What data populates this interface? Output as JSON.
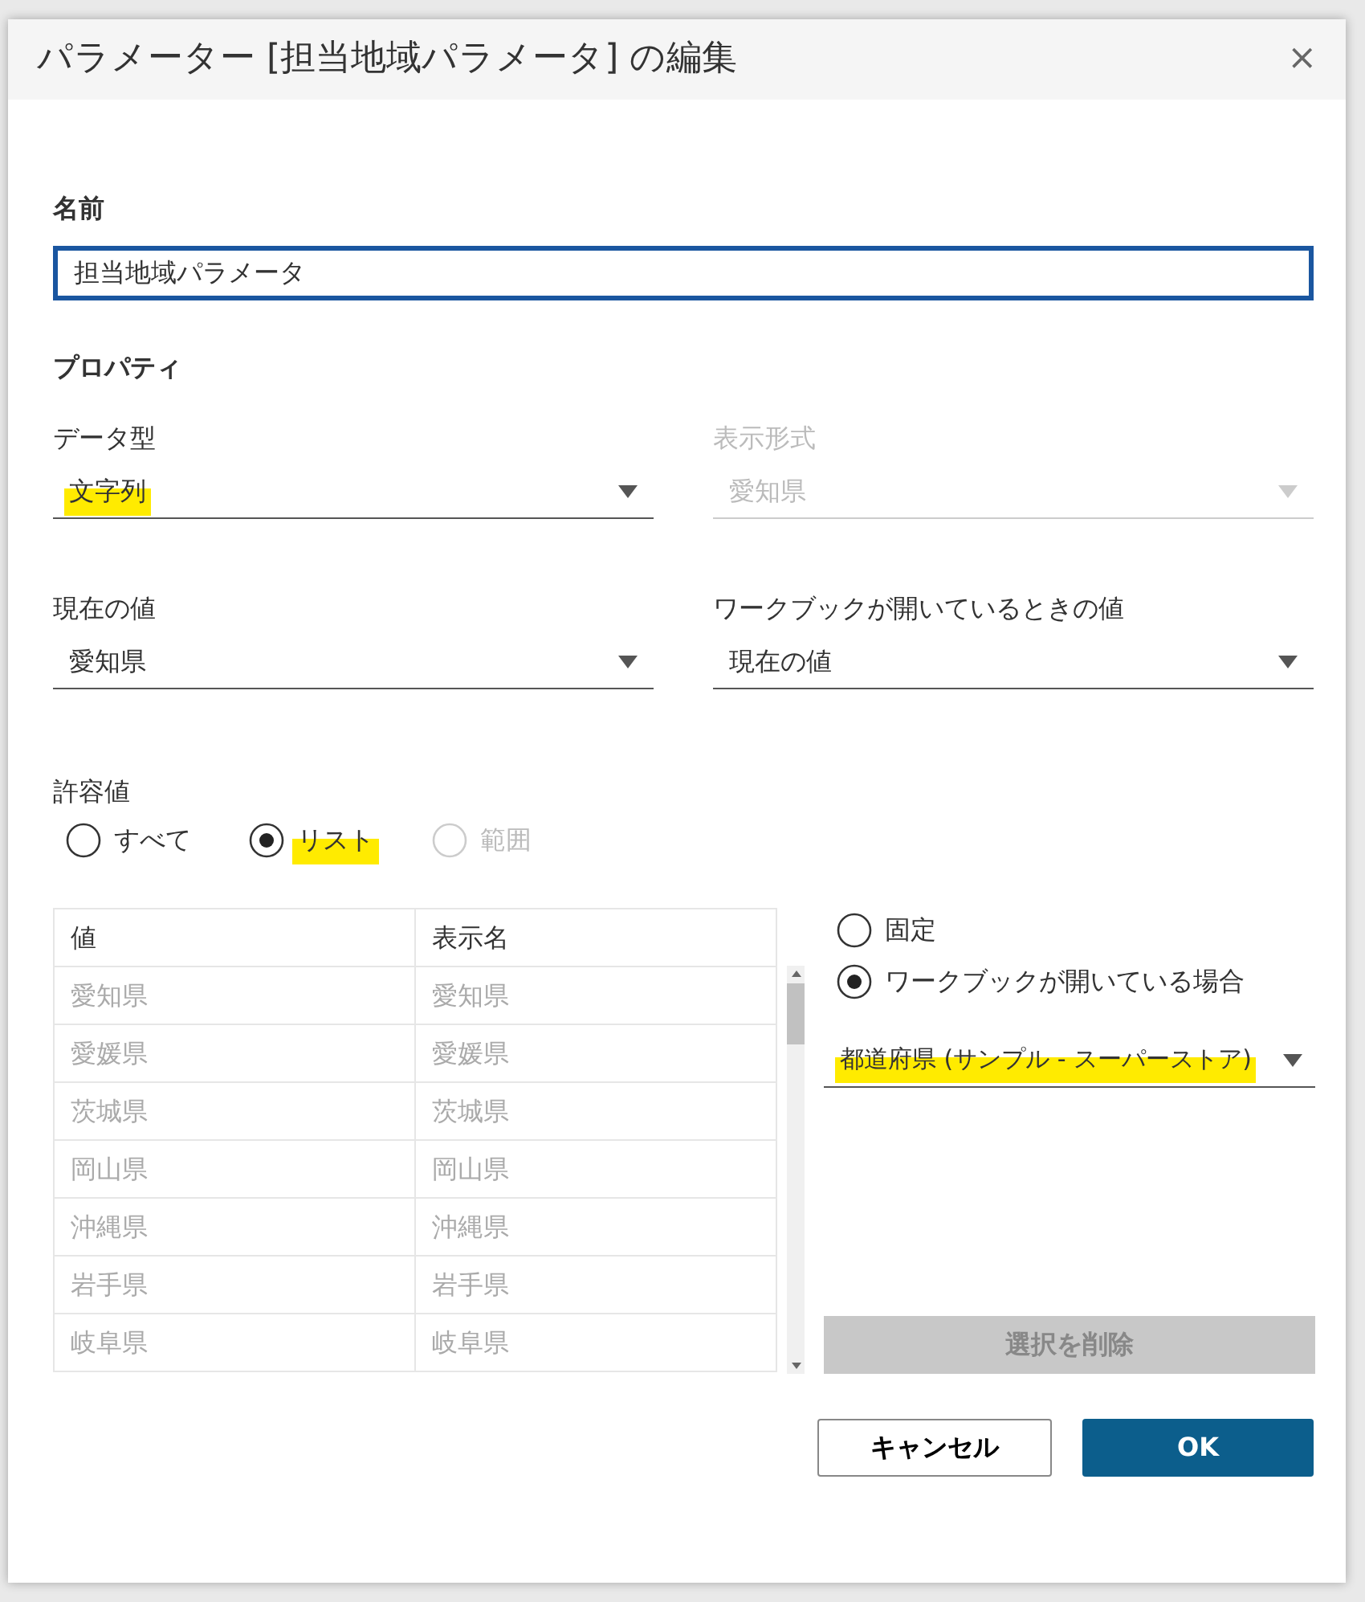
{
  "dialog": {
    "title": "パラメーター [担当地域パラメータ] の編集",
    "close": "×"
  },
  "name_section": {
    "label": "名前",
    "value": "担当地域パラメータ"
  },
  "properties": {
    "heading": "プロパティ",
    "dropdowns": [
      {
        "label": "データ型",
        "value": "文字列",
        "disabled": false,
        "highlighted": true
      },
      {
        "label": "表示形式",
        "value": "愛知県",
        "disabled": true,
        "highlighted": false
      },
      {
        "label": "現在の値",
        "value": "愛知県",
        "disabled": false,
        "highlighted": false
      },
      {
        "label": "ワークブックが開いているときの値",
        "value": "現在の値",
        "disabled": false,
        "highlighted": false
      }
    ]
  },
  "allowable": {
    "label": "許容値",
    "options": [
      {
        "label": "すべて",
        "selected": false,
        "disabled": false,
        "highlighted": false
      },
      {
        "label": "リスト",
        "selected": true,
        "disabled": false,
        "highlighted": true
      },
      {
        "label": "範囲",
        "selected": false,
        "disabled": true,
        "highlighted": false
      }
    ]
  },
  "list_table": {
    "columns": [
      "値",
      "表示名"
    ],
    "rows": [
      [
        "愛知県",
        "愛知県"
      ],
      [
        "愛媛県",
        "愛媛県"
      ],
      [
        "茨城県",
        "茨城県"
      ],
      [
        "岡山県",
        "岡山県"
      ],
      [
        "沖縄県",
        "沖縄県"
      ],
      [
        "岩手県",
        "岩手県"
      ],
      [
        "岐阜県",
        "岐阜県"
      ]
    ]
  },
  "source": {
    "options": [
      {
        "label": "固定",
        "selected": false
      },
      {
        "label": "ワークブックが開いている場合",
        "selected": true
      }
    ],
    "field": {
      "value": "都道府県 (サンプル - スーパーストア)",
      "highlighted": true
    },
    "remove_button": {
      "label": "選択を削除",
      "disabled": true
    }
  },
  "buttons": [
    {
      "label": "キャンセル",
      "kind": "secondary"
    },
    {
      "label": "OK",
      "kind": "primary"
    }
  ]
}
